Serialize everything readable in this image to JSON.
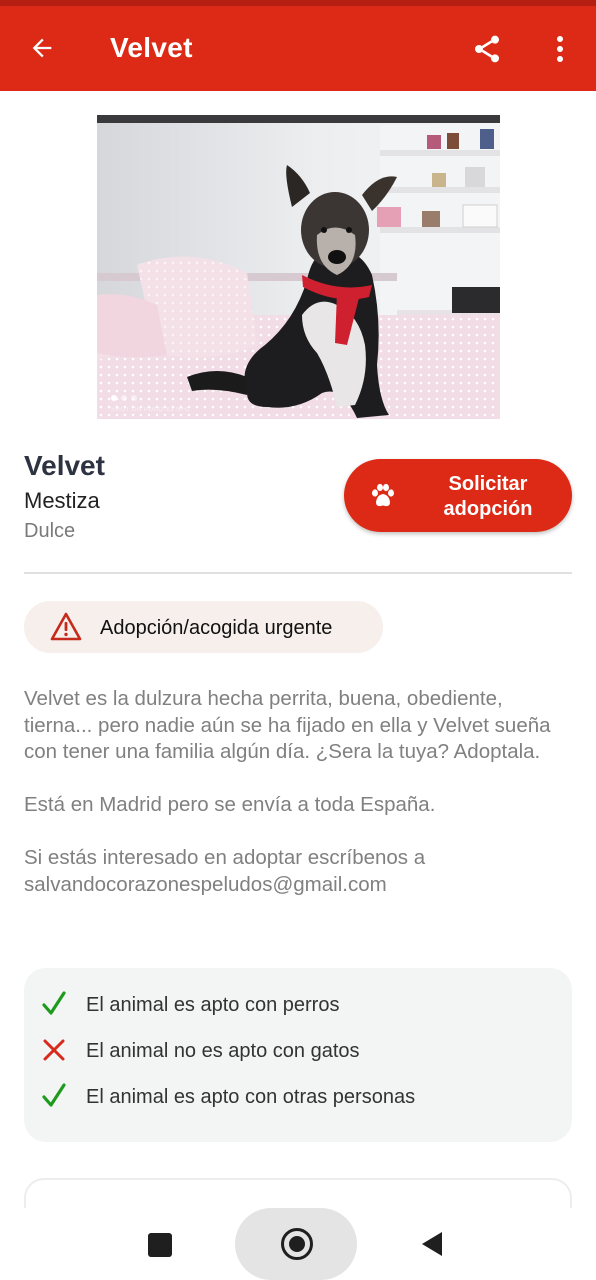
{
  "appbar": {
    "title": "Velvet"
  },
  "photo": {
    "watermark": "SHOT ON POCO X3 NFC",
    "carousel_count": 3,
    "carousel_active": 1
  },
  "pet": {
    "name": "Velvet",
    "breed": "Mestiza",
    "temperament": "Dulce"
  },
  "adopt_button": {
    "line1": "Solicitar",
    "line2": "adopción"
  },
  "urgent_badge": {
    "label": "Adopción/acogida urgente"
  },
  "description": {
    "paragraphs": [
      "Velvet es la dulzura hecha perrita, buena, obediente, tierna... pero nadie aún se ha fijado en ella y Velvet sueña con tener una familia algún día. ¿Sera la tuya? Adoptala.",
      "Está en Madrid pero se envía a toda España.",
      "Si estás interesado en adoptar escríbenos a salvandocorazonespeludos@gmail.com"
    ]
  },
  "compatibility": [
    {
      "ok": true,
      "text": "El animal es apto con perros"
    },
    {
      "ok": false,
      "text": "El animal no es apto con gatos"
    },
    {
      "ok": true,
      "text": "El animal es apto con otras personas"
    }
  ],
  "colors": {
    "brand_red": "#dd2a16",
    "check_green": "#1e9b1e",
    "cross_red": "#d62a1c",
    "warning_red": "#c62a1a"
  },
  "icons": {
    "back": "arrow-left-icon",
    "share": "share-icon",
    "more": "more-vertical-icon",
    "adopt": "paw-icon",
    "urgent": "warning-triangle-icon",
    "ok": "check-icon",
    "not_ok": "cross-icon"
  }
}
